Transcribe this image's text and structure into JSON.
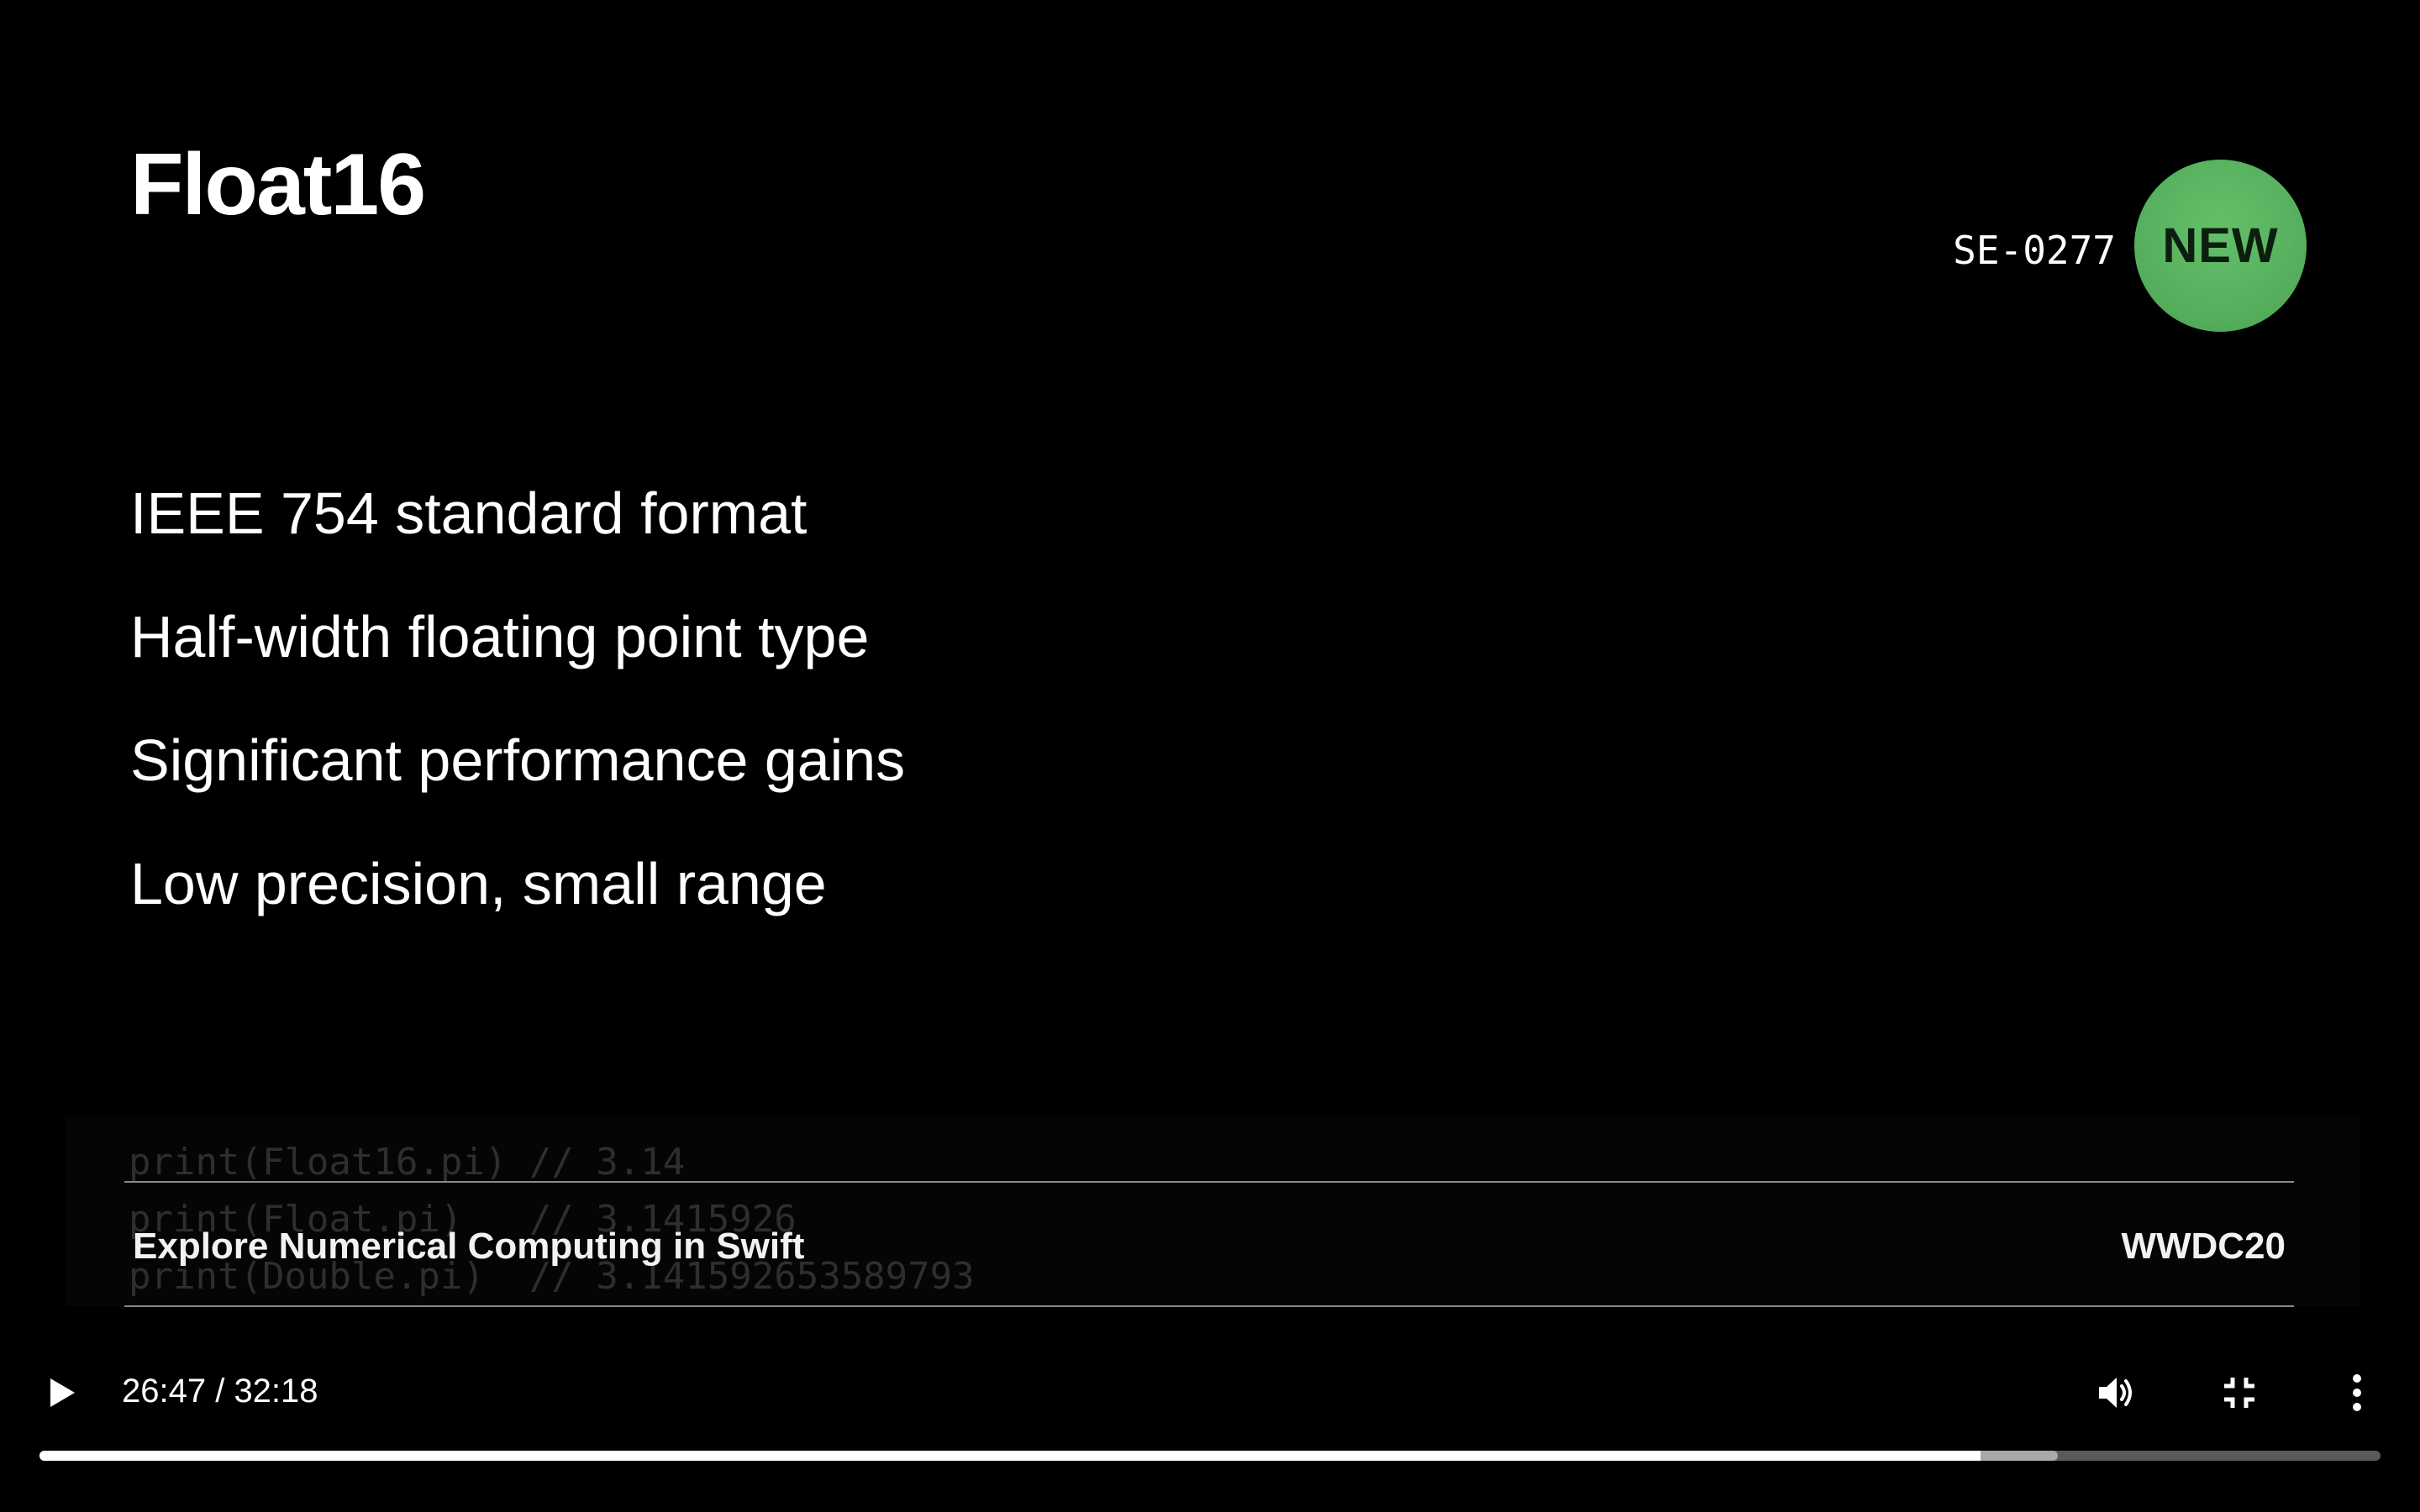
{
  "slide": {
    "title": "Float16",
    "proposal_id": "SE-0277",
    "badge_label": "NEW",
    "badge_color": "#57b25e",
    "bullets": [
      "IEEE 754 standard format",
      "Half-width floating point type",
      "Significant performance gains",
      "Low precision, small range"
    ]
  },
  "next_slide_preview": {
    "code_lines": [
      "print(Float16.pi) // 3.14",
      "print(Float.pi)   // 3.1415926",
      "print(Double.pi)  // 3.141592653589793"
    ]
  },
  "info_bar": {
    "session_title": "Explore Numerical Computing in Swift",
    "event": "WWDC20"
  },
  "player": {
    "time_display": "26:47 / 32:18",
    "progress_played": 0.829,
    "progress_buffered": 0.862,
    "icons": {
      "play": "play-icon",
      "volume": "volume-icon",
      "exit_fullscreen": "exit-fullscreen-icon",
      "more": "more-vertical-icon"
    }
  }
}
